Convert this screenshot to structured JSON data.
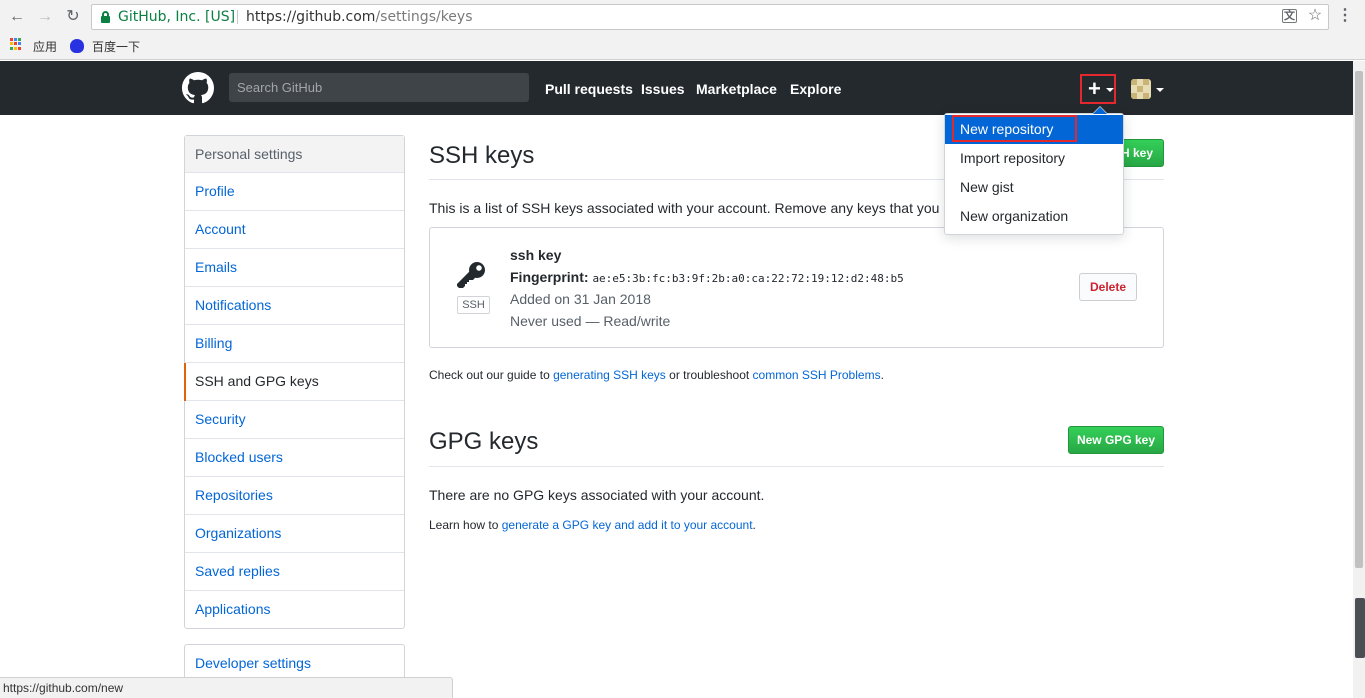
{
  "browser": {
    "site_identity": "GitHub, Inc. [US]",
    "url_host": "https://github.com",
    "url_path": "/settings/keys",
    "bookmarks": [
      {
        "label": "应用"
      },
      {
        "label": "百度一下"
      }
    ],
    "status_url": "https://github.com/new"
  },
  "header": {
    "search_placeholder": "Search GitHub",
    "nav": [
      "Pull requests",
      "Issues",
      "Marketplace",
      "Explore"
    ],
    "plus_label": "+"
  },
  "dropdown": {
    "items": [
      "New repository",
      "Import repository",
      "New gist",
      "New organization"
    ]
  },
  "sidebar": {
    "heading": "Personal settings",
    "items": [
      "Profile",
      "Account",
      "Emails",
      "Notifications",
      "Billing",
      "SSH and GPG keys",
      "Security",
      "Blocked users",
      "Repositories",
      "Organizations",
      "Saved replies",
      "Applications"
    ],
    "selected": "SSH and GPG keys",
    "developer": "Developer settings"
  },
  "ssh": {
    "title": "SSH keys",
    "new_button_partial": "H key",
    "description": "This is a list of SSH keys associated with your account. Remove any keys that you do",
    "key": {
      "name": "ssh key",
      "fingerprint_label": "Fingerprint:",
      "fingerprint": "ae:e5:3b:fc:b3:9f:2b:a0:ca:22:72:19:12:d2:48:b5",
      "added": "Added on 31 Jan 2018",
      "usage": "Never used — Read/write",
      "type_label": "SSH",
      "delete_label": "Delete"
    },
    "guide_prefix": "Check out our guide to ",
    "guide_link1": "generating SSH keys",
    "guide_middle": " or troubleshoot ",
    "guide_link2": "common SSH Problems",
    "guide_suffix": "."
  },
  "gpg": {
    "title": "GPG keys",
    "new_button": "New GPG key",
    "empty": "There are no GPG keys associated with your account.",
    "learn_prefix": "Learn how to ",
    "learn_link": "generate a GPG key and add it to your account",
    "learn_suffix": "."
  },
  "colors": {
    "header_bg": "#24292e",
    "link": "#0366d6",
    "green": "#28a745",
    "highlight_red": "#e5282e",
    "dropdown_active": "#0366d6"
  }
}
